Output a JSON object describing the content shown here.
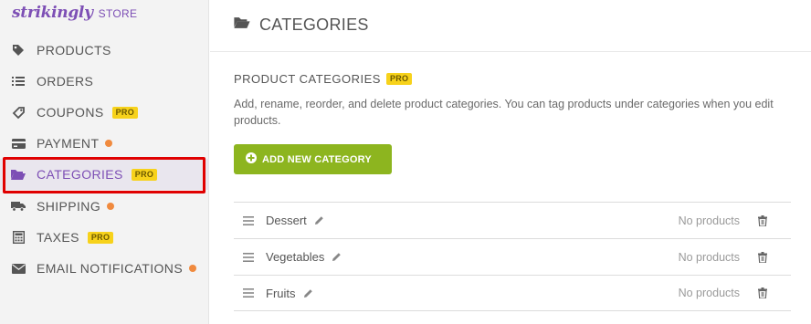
{
  "brand": {
    "logo": "strikingly",
    "store": "STORE"
  },
  "nav": [
    {
      "id": "products",
      "label": "PRODUCTS",
      "icon": "tag-icon",
      "pro": "",
      "dot": false,
      "active": false
    },
    {
      "id": "orders",
      "label": "ORDERS",
      "icon": "list-icon",
      "pro": "",
      "dot": false,
      "active": false
    },
    {
      "id": "coupons",
      "label": "COUPONS",
      "icon": "coupon-tag-icon",
      "pro": "PRO",
      "dot": false,
      "active": false
    },
    {
      "id": "payment",
      "label": "PAYMENT",
      "icon": "credit-card-icon",
      "pro": "",
      "dot": true,
      "active": false
    },
    {
      "id": "categories",
      "label": "CATEGORIES",
      "icon": "folder-open-icon",
      "pro": "PRO",
      "dot": false,
      "active": true
    },
    {
      "id": "shipping",
      "label": "SHIPPING",
      "icon": "truck-icon",
      "pro": "",
      "dot": true,
      "active": false
    },
    {
      "id": "taxes",
      "label": "TAXES",
      "icon": "calculator-icon",
      "pro": "PRO",
      "dot": false,
      "active": false
    },
    {
      "id": "email-notifications",
      "label": "EMAIL NOTIFICATIONS",
      "icon": "envelope-icon",
      "pro": "",
      "dot": true,
      "active": false
    }
  ],
  "colors": {
    "accent": "#7d4fb5",
    "pro_badge": "#f7d21b",
    "notice_dot": "#f08a3e",
    "button": "#8db51f",
    "highlight": "#e00000"
  },
  "page": {
    "title": "CATEGORIES",
    "section_title": "PRODUCT CATEGORIES",
    "section_pro": "PRO",
    "description": "Add, rename, reorder, and delete product categories. You can tag products under categories when you edit products.",
    "add_button": "ADD NEW CATEGORY"
  },
  "categories": [
    {
      "name": "Dessert",
      "count": "No products"
    },
    {
      "name": "Vegetables",
      "count": "No products"
    },
    {
      "name": "Fruits",
      "count": "No products"
    }
  ]
}
